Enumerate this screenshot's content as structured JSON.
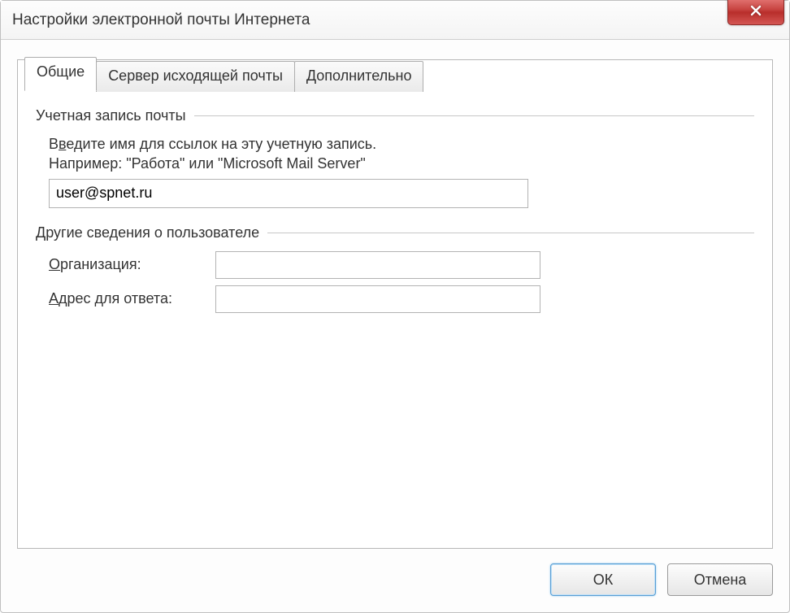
{
  "window": {
    "title": "Настройки электронной почты Интернета"
  },
  "tabs": {
    "general": "Общие",
    "outgoing": "Сервер исходящей почты",
    "advanced": "Дополнительно"
  },
  "section_account": {
    "legend": "Учетная запись почты",
    "help_line1_prefix": "В",
    "help_line1_ul": "в",
    "help_line1_rest": "едите имя для ссылок на эту учетную запись.",
    "help_line2": "Например: \"Работа\" или \"Microsoft Mail Server\"",
    "value": "user@spnet.ru"
  },
  "section_user": {
    "legend": "Другие сведения о пользователе",
    "org_label_ul": "О",
    "org_label_rest": "рганизация:",
    "org_value": "",
    "reply_label_ul": "А",
    "reply_label_rest": "дрес для ответа:",
    "reply_value": ""
  },
  "buttons": {
    "ok": "ОК",
    "cancel": "Отмена"
  }
}
